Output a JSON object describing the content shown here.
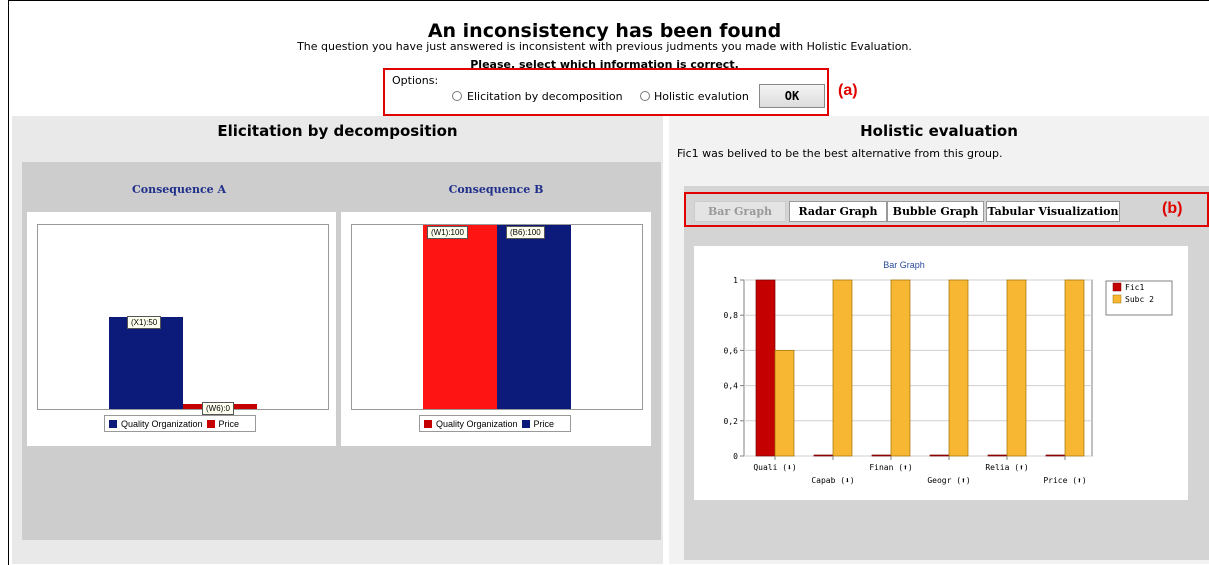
{
  "header": {
    "title": "An inconsistency has been found",
    "subtitle": "The question you have just answered is inconsistent with previous judments you made with Holistic Evaluation.",
    "prompt": "Please, select which information is correct."
  },
  "options": {
    "label": "Options:",
    "radio1": "Elicitation by decomposition",
    "radio2": "Holistic evalution",
    "ok": "OK",
    "annotation": "(a)"
  },
  "left": {
    "title": "Elicitation by decomposition",
    "consequence_a": {
      "title": "Consequence A",
      "label1": "(X1):50",
      "label2": "(W6):0",
      "legend": [
        "Quality Organization",
        "Price"
      ]
    },
    "consequence_b": {
      "title": "Consequence B",
      "label1": "(W1):100",
      "label2": "(B6):100",
      "legend": [
        "Quality Organization",
        "Price"
      ]
    }
  },
  "right": {
    "title": "Holistic evaluation",
    "description": "Fic1 was belived to be the best alternative from this group.",
    "tabs": [
      "Bar Graph",
      "Radar Graph",
      "Bubble Graph",
      "Tabular Visualization"
    ],
    "annotation": "(b)"
  },
  "colors": {
    "red": "#e00000",
    "navy": "#0c1a7a",
    "bar_red": "#c40000",
    "bar_orange": "#f7b733"
  },
  "chart_data": [
    {
      "type": "bar",
      "title": "Consequence A",
      "categories": [
        "Quality Organization",
        "Price"
      ],
      "values": [
        50,
        0
      ],
      "data_labels": [
        "(X1):50",
        "(W6):0"
      ],
      "ylim": [
        0,
        100
      ]
    },
    {
      "type": "bar",
      "title": "Consequence B",
      "categories": [
        "Quality Organization",
        "Price"
      ],
      "values": [
        100,
        100
      ],
      "data_labels": [
        "(W1):100",
        "(B6):100"
      ],
      "ylim": [
        0,
        100
      ]
    },
    {
      "type": "bar",
      "title": "Bar Graph",
      "categories": [
        "Quali (⬇)",
        "Capab (⬇)",
        "Finan (⬆)",
        "Geogr (⬆)",
        "Relia (⬆)",
        "Price (⬆)"
      ],
      "series": [
        {
          "name": "Fic1",
          "values": [
            1,
            0,
            0,
            0,
            0,
            0
          ]
        },
        {
          "name": "Subc 2",
          "values": [
            0.6,
            1,
            1,
            1,
            1,
            1
          ]
        }
      ],
      "yticks": [
        "0",
        "0,2",
        "0,4",
        "0,6",
        "0,8",
        "1"
      ],
      "ylim": [
        0,
        1
      ],
      "grid": true,
      "legend": "right"
    }
  ]
}
